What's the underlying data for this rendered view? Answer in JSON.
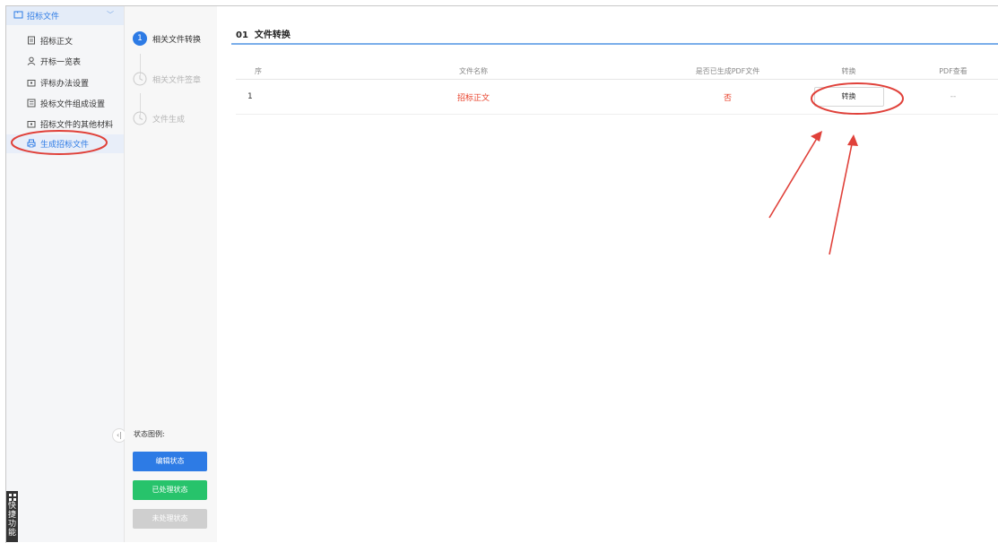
{
  "sidebar": {
    "header": "招标文件",
    "items": [
      {
        "label": "招标正文",
        "icon": "document-icon"
      },
      {
        "label": "开标一览表",
        "icon": "user-icon"
      },
      {
        "label": "评标办法设置",
        "icon": "briefcase-icon"
      },
      {
        "label": "投标文件组成设置",
        "icon": "list-icon"
      },
      {
        "label": "招标文件的其他材料",
        "icon": "briefcase-icon"
      },
      {
        "label": "生成招标文件",
        "icon": "printer-icon"
      }
    ],
    "active_index": 5,
    "collapse_symbol": "‹|",
    "quick_label": "快捷功能"
  },
  "steps": {
    "items": [
      {
        "number": "1",
        "label": "相关文件转换"
      },
      {
        "label": "相关文件签章"
      },
      {
        "label": "文件生成"
      }
    ],
    "legend_title": "状态图例:",
    "legend": [
      {
        "label": "编辑状态",
        "color": "#2d7be5"
      },
      {
        "label": "已处理状态",
        "color": "#27c36b"
      },
      {
        "label": "未处理状态",
        "color": "#cfcfcf"
      }
    ]
  },
  "main": {
    "title": "01  文件转换",
    "table": {
      "headers": [
        "序",
        "文件名称",
        "是否已生成PDF文件",
        "转换",
        "PDF查看"
      ],
      "rows": [
        {
          "index": "1",
          "name": "招标正文",
          "pdf_generated": "否",
          "action": "转换",
          "view": "--"
        }
      ]
    }
  },
  "colors": {
    "accent": "#2d7be5",
    "highlight_red": "#e8402a",
    "annotation_red": "#e0413a"
  }
}
